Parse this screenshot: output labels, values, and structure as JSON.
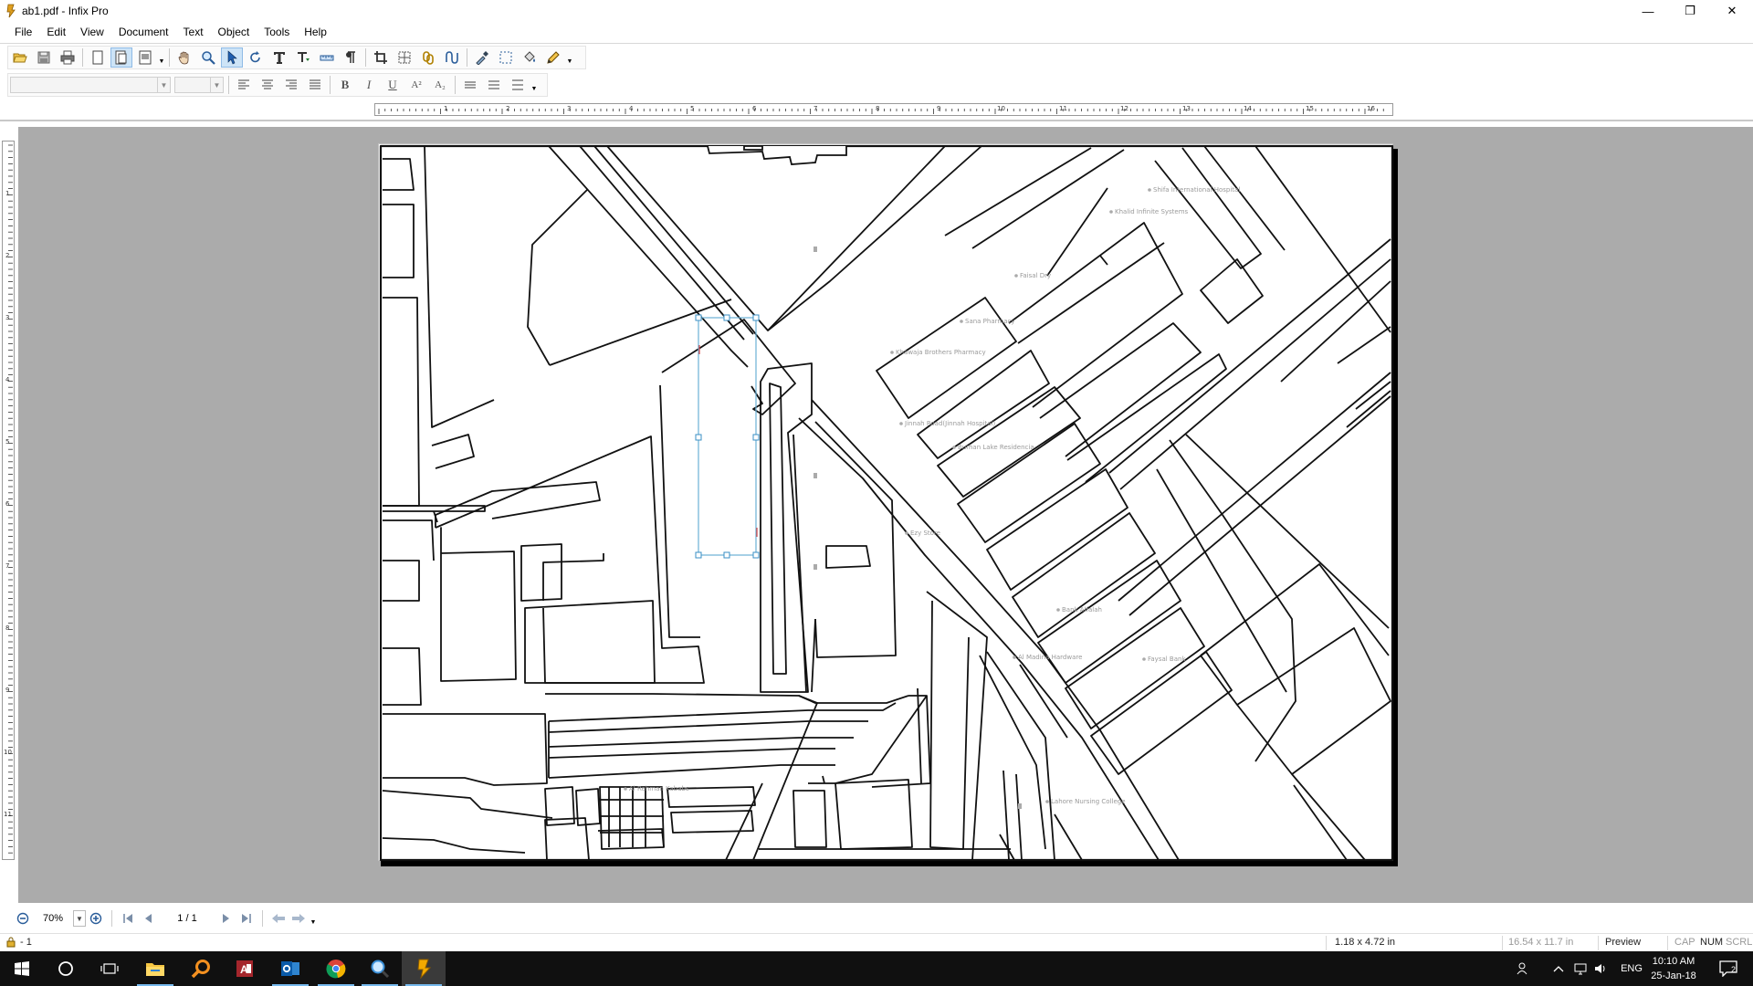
{
  "window": {
    "title": "ab1.pdf - Infix Pro",
    "minimize_glyph": "—",
    "restore_glyph": "❐",
    "close_glyph": "✕"
  },
  "menu": [
    "File",
    "Edit",
    "View",
    "Document",
    "Text",
    "Object",
    "Tools",
    "Help"
  ],
  "toolbar_icons": [
    "open-icon",
    "save-icon",
    "print-icon",
    "single-page-icon",
    "facing-pages-icon",
    "continuous-pages-icon",
    "hand-tool-icon",
    "zoom-tool-icon",
    "select-tool-icon",
    "rotate-tool-icon",
    "text-tool-icon",
    "text-flow-icon",
    "measure-icon",
    "paragraph-icon",
    "crop-icon",
    "image-frame-icon",
    "link-icon",
    "path-icon",
    "eyedropper-icon",
    "marquee-icon",
    "fill-icon",
    "pencil-icon"
  ],
  "format_toolbar": {
    "font_name": "",
    "font_size": "",
    "bold_glyph": "B",
    "italic_glyph": "I",
    "underline_glyph": "U",
    "superscript_glyph": "A²",
    "subscript_glyph": "A₂"
  },
  "ruler": {
    "horizontal_labels": [
      "1",
      "2",
      "3",
      "4",
      "5",
      "6",
      "7",
      "8",
      "9",
      "10",
      "11",
      "12",
      "13",
      "14",
      "15",
      "16"
    ],
    "vertical_labels": [
      "1",
      "2",
      "3",
      "4",
      "5",
      "6",
      "7",
      "8",
      "9",
      "10",
      "11"
    ]
  },
  "map_labels": [
    "Shifa International Hospital",
    "Khalid Infinite Systems",
    "Faisal Dry",
    "Sana Pharmacy",
    "Khawaja Brothers Pharmacy",
    "Jinnah Road(Jinnah Hospital)",
    "Burhan Lake Residencia",
    "Ezy Store",
    "Bank Alfalah",
    "Al Madina Hardware",
    "Faysal Bank",
    "Al Rehman Kababs",
    "Lahore Nursing College"
  ],
  "navigation": {
    "zoom_value": "70%",
    "page_indicator": "1 / 1"
  },
  "status": {
    "lock_text": "- 1",
    "selection_size": "1.18 x 4.72 in",
    "page_size": "16.54 x 11.7 in",
    "mode": "Preview",
    "cap": "CAP",
    "num": "NUM",
    "scrl": "SCRL"
  },
  "taskbar": {
    "apps": [
      "start-icon",
      "cortana-icon",
      "task-view-icon",
      "file-explorer-icon",
      "search-app-icon",
      "access-icon",
      "outlook-icon",
      "chrome-icon",
      "magnifier-icon",
      "infix-icon"
    ],
    "language": "ENG",
    "time": "10:10 AM",
    "date": "25-Jan-18",
    "notifications_count": "2"
  }
}
